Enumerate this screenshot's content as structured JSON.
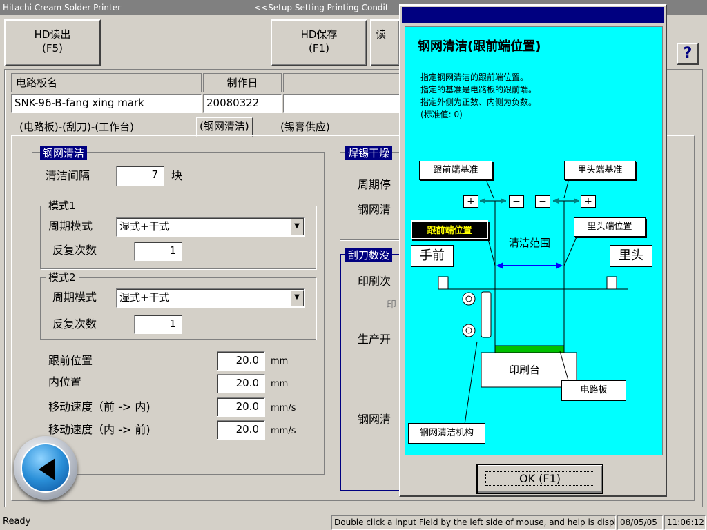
{
  "window": {
    "title": "Hitachi Cream Solder Printer",
    "subtitle": "<<Setup Setting Printing Condit"
  },
  "toolbar": {
    "hd_load": {
      "line1": "HD读出",
      "line2": "(F5)"
    },
    "hd_save": {
      "line1": "HD保存",
      "line2": "(F1)"
    },
    "third_partial": "读",
    "help": "?"
  },
  "board": {
    "name_header": "电路板名",
    "date_header": "制作日",
    "name_value": "SNK-96-B-fang xing mark",
    "date_value": "20080322",
    "extra_value": ""
  },
  "tabs": [
    {
      "label": "(电路板)-(刮刀)-(工作台)",
      "active": false
    },
    {
      "label": "(钢网清洁)",
      "active": true
    },
    {
      "label": "(锡膏供应)",
      "active": false
    }
  ],
  "cleaning": {
    "title": "钢网清洁",
    "interval_label": "清洁间隔",
    "interval_value": "7",
    "interval_unit": "块",
    "mode1": {
      "title": "模式1",
      "cycle_label": "周期模式",
      "cycle_value": "湿式+干式",
      "repeat_label": "反复次数",
      "repeat_value": "1"
    },
    "mode2": {
      "title": "模式2",
      "cycle_label": "周期模式",
      "cycle_value": "湿式+干式",
      "repeat_label": "反复次数",
      "repeat_value": "1"
    },
    "front_pos_label": "跟前位置",
    "front_pos_value": "20.0",
    "inner_pos_label": "内位置",
    "inner_pos_value": "20.0",
    "speed_fwd_label": "移动速度（前 -> 内)",
    "speed_fwd_value": "20.0",
    "speed_back_label": "移动速度（内 -> 前)",
    "speed_back_value": "20.0",
    "unit_mm": "mm",
    "unit_mms": "mm/s"
  },
  "right_groups": {
    "solder_title": "焊锡干燥",
    "cycle_stop": "周期停",
    "stencil_clean": "钢网清",
    "blade_title": "刮刀数没",
    "print_count": "印刷次",
    "print_gray": "印",
    "prod_start": "生产开",
    "stencil_clean2": "钢网清"
  },
  "dialog": {
    "heading": "钢网清洁(跟前端位置)",
    "desc": [
      "指定钢网清洁的跟前端位置。",
      "指定的基准是电路板的跟前端。",
      "指定外侧为正数、内侧为负数。",
      "(标准值: 0)"
    ],
    "labels": {
      "front_ref": "跟前端基准",
      "back_ref": "里头端基准",
      "front_pos": "跟前端位置",
      "back_pos": "里头端位置",
      "clean_range": "清洁范围",
      "front": "手前",
      "back": "里头",
      "table": "印刷台",
      "board": "电路板",
      "mechanism": "钢网清洁机构"
    },
    "signs": {
      "plus": "+",
      "minus": "−"
    },
    "ok": "OK (F1)"
  },
  "status": {
    "ready": "Ready",
    "hint": "Double click a input Field by the left side of mouse, and help is displayed",
    "date": "08/05/05",
    "time": "11:06:12"
  }
}
